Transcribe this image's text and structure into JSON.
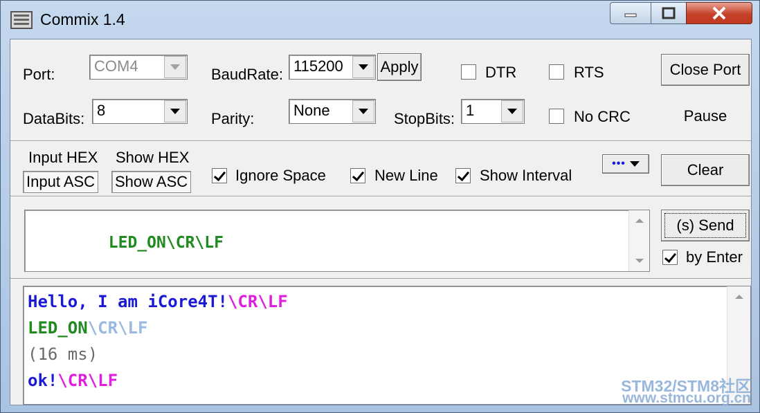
{
  "window": {
    "title": "Commix 1.4",
    "icon": "terminal-icon"
  },
  "config": {
    "port_label": "Port:",
    "port_value": "COM4",
    "baud_label": "BaudRate:",
    "baud_value": "115200",
    "apply_label": "Apply",
    "dtr_label": "DTR",
    "rts_label": "RTS",
    "close_port_label": "Close Port",
    "databits_label": "DataBits:",
    "databits_value": "8",
    "parity_label": "Parity:",
    "parity_value": "None",
    "stopbits_label": "StopBits:",
    "stopbits_value": "1",
    "nocrc_label": "No CRC",
    "pause_label": "Pause"
  },
  "options": {
    "input_hex": "Input HEX",
    "input_asc": "Input ASC",
    "show_hex": "Show HEX",
    "show_asc": "Show ASC",
    "ignore_space": "Ignore Space",
    "new_line": "New Line",
    "show_interval": "Show Interval",
    "more_label": "•••",
    "clear_label": "Clear"
  },
  "send": {
    "input_prefix": "LED_ON",
    "input_suffix": "\\CR\\LF",
    "send_label": "(s) Send",
    "by_enter_label": "by Enter"
  },
  "output": {
    "line1_text": "Hello, I am iCore4T!",
    "line1_suffix": "\\CR\\LF",
    "line2_text": "LED_ON",
    "line2_suffix": "\\CR\\LF",
    "line3_text": "(16 ms)",
    "line4_text": "ok!",
    "line4_suffix": "\\CR\\LF"
  },
  "watermark": {
    "line1": "STM32/STM8社区",
    "line2": "www.stmcu.org.cn"
  },
  "colors": {
    "sent": "#1a1ad6",
    "echo": "#1f8a1f",
    "control": "#e01ee0",
    "interval": "#6a6a6a"
  }
}
